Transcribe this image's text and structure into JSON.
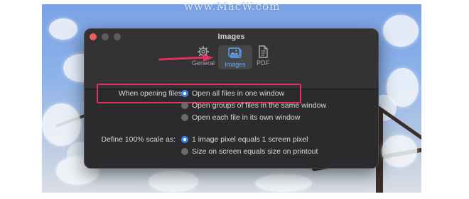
{
  "watermark": "www.MacW.com",
  "window": {
    "title": "Images",
    "toolbar": [
      {
        "label": "General",
        "icon": "gear-icon",
        "selected": false
      },
      {
        "label": "Images",
        "icon": "photo-icon",
        "selected": true
      },
      {
        "label": "PDF",
        "icon": "document-icon",
        "selected": false
      }
    ]
  },
  "opening": {
    "label": "When opening files:",
    "options": [
      {
        "label": "Open all files in one window",
        "selected": true
      },
      {
        "label": "Open groups of files in the same window",
        "selected": false
      },
      {
        "label": "Open each file in its own window",
        "selected": false
      }
    ]
  },
  "scale": {
    "label": "Define 100% scale as:",
    "options": [
      {
        "label": "1 image pixel equals 1 screen pixel",
        "selected": true
      },
      {
        "label": "Size on screen equals size on printout",
        "selected": false
      }
    ]
  },
  "colors": {
    "annotation": "#e0315b",
    "accent": "#3a84f7",
    "window_bg": "#2b2b2d"
  }
}
